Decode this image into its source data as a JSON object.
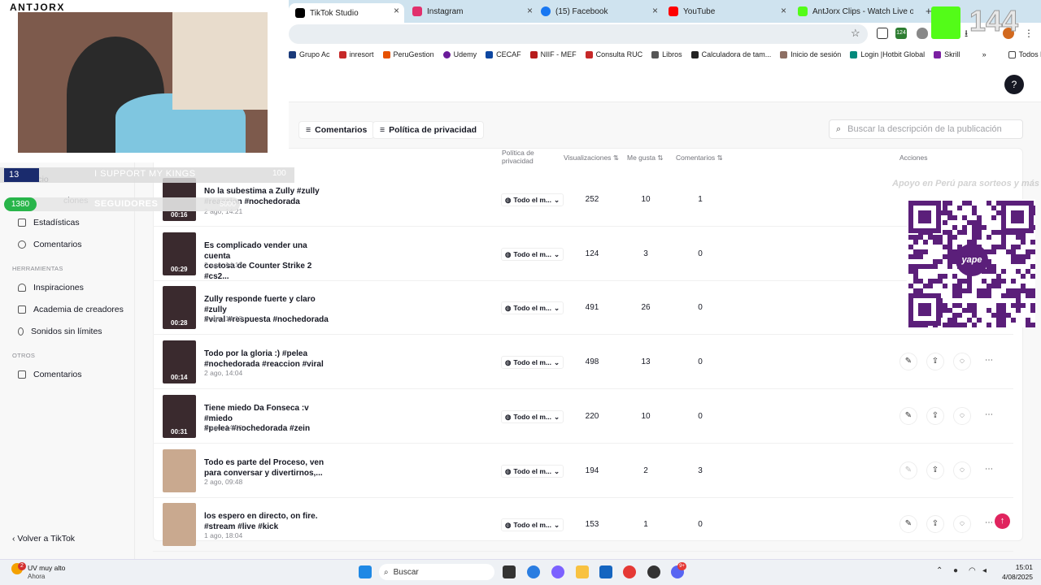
{
  "browser": {
    "tabs": [
      {
        "label": "TikTok Studio",
        "color": "#000000"
      },
      {
        "label": "Instagram",
        "color": "#e1306c"
      },
      {
        "label": "(15) Facebook",
        "color": "#1877f2"
      },
      {
        "label": "YouTube",
        "color": "#ff0000"
      },
      {
        "label": "AntJorx Clips - Watch Live on K",
        "color": "#53fc18"
      }
    ],
    "bookmarks": [
      "Grupo Ac",
      "inresort",
      "PeruGestion",
      "Udemy",
      "CECAF",
      "NIIF - MEF",
      "Consulta RUC",
      "Libros",
      "Calculadora de tam...",
      "Inicio de sesión",
      "Login |Hotbit Global",
      "Skrill"
    ],
    "bookmarks_more": "»",
    "all_favorites": "Todos los favoritos",
    "extension_badge": "124"
  },
  "stream_overlay": {
    "channel": "ANTJORX",
    "bar_count": "13",
    "bar_text": "I SUPPORT MY KINGS",
    "bar_goal": "100",
    "followers_count": "1380",
    "followers_label": "SEGUIDORES",
    "followers_goal": "5000",
    "kick_viewers": "144",
    "promo_text": "Apoyo en Perú para sorteos y más",
    "yape_label": "yape"
  },
  "sidebar": {
    "item_partial_1": "icio",
    "item_partial_2": "ciones",
    "items_top": [
      {
        "label": "Estadísticas",
        "icon": "chart-icon"
      },
      {
        "label": "Comentarios",
        "icon": "comment-icon"
      }
    ],
    "section_tools": "HERRAMIENTAS",
    "tools": [
      {
        "label": "Inspiraciones",
        "icon": "bulb-icon"
      },
      {
        "label": "Academia de creadores",
        "icon": "academy-icon"
      },
      {
        "label": "Sonidos sin límites",
        "icon": "music-icon"
      }
    ],
    "section_others": "OTROS",
    "others": [
      {
        "label": "Comentarios",
        "icon": "comment-icon"
      }
    ],
    "back_label": "Volver a TikTok"
  },
  "filters": {
    "comments": "Comentarios",
    "privacy": "Política de privacidad"
  },
  "search": {
    "placeholder": "Buscar la descripción de la publicación"
  },
  "table": {
    "headers": {
      "privacy_l1": "Política de",
      "privacy_l2": "privacidad",
      "views": "Visualizaciones",
      "likes": "Me gusta",
      "comments": "Comentarios",
      "actions": "Acciones"
    },
    "rows": [
      {
        "title_l1": "No la subestima a Zully #zully",
        "title_l2": "#reaccion #nochedorada",
        "date": "2 ago, 14:21",
        "duration": "00:16",
        "privacy": "Todo el m...",
        "views": "252",
        "likes": "10",
        "comments": "1"
      },
      {
        "title_l1": "Es complicado vender una cuenta",
        "title_l2": "costosa de Counter Strike 2 #cs2...",
        "date": "2 ago, 14:17",
        "duration": "00:29",
        "privacy": "Todo el m...",
        "views": "124",
        "likes": "3",
        "comments": "0"
      },
      {
        "title_l1": "Zully responde fuerte y claro #zully",
        "title_l2": "#viral #respuesta #nochedorada",
        "date": "2 ago, 14:13",
        "duration": "00:28",
        "privacy": "Todo el m...",
        "views": "491",
        "likes": "26",
        "comments": "0"
      },
      {
        "title_l1": "Todo por la gloria :) #pelea",
        "title_l2": "#nochedorada #reaccion #viral",
        "date": "2 ago, 14:04",
        "duration": "00:14",
        "privacy": "Todo el m...",
        "views": "498",
        "likes": "13",
        "comments": "0"
      },
      {
        "title_l1": "Tiene miedo Da Fonseca :v #miedo",
        "title_l2": "#pelea #nochedorada #zein",
        "date": "2 ago, 14:00",
        "duration": "00:31",
        "privacy": "Todo el m...",
        "views": "220",
        "likes": "10",
        "comments": "0"
      },
      {
        "title_l1": "Todo es parte del Proceso, ven",
        "title_l2": "para conversar y divertirnos,...",
        "date": "2 ago, 09:48",
        "duration": "",
        "privacy": "Todo el m...",
        "views": "194",
        "likes": "2",
        "comments": "3"
      },
      {
        "title_l1": "los espero en directo, on fire.",
        "title_l2": "#stream #live #kick",
        "date": "1 ago, 18:04",
        "duration": "",
        "privacy": "Todo el m...",
        "views": "153",
        "likes": "1",
        "comments": "0"
      }
    ]
  },
  "taskbar": {
    "weather_badge": "2",
    "weather_title": "UV muy alto",
    "weather_sub": "Ahora",
    "search_label": "Buscar",
    "notif_badge": "9+",
    "time": "15:01",
    "date": "4/08/2025"
  }
}
